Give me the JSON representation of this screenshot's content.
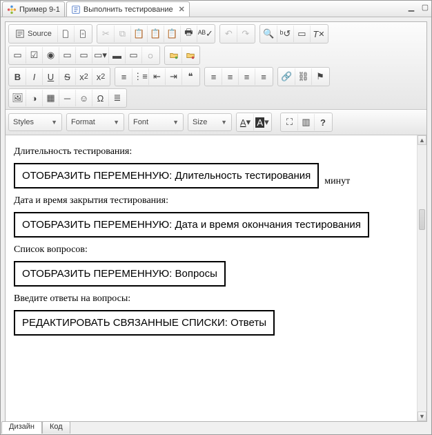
{
  "tabs": {
    "left": "Пример 9-1",
    "right": "Выполнить тестирование"
  },
  "toolbar": {
    "source_label": "Source"
  },
  "dropdowns": {
    "styles": "Styles",
    "format": "Format",
    "font": "Font",
    "size": "Size"
  },
  "content": {
    "p1": "Длительность тестирования:",
    "box1": "ОТОБРАЗИТЬ ПЕРЕМЕННУЮ: Длительность тестирования",
    "suffix1": "минут",
    "p2": "Дата и время закрытия тестирования:",
    "box2": "ОТОБРАЗИТЬ ПЕРЕМЕННУЮ: Дата и время окончания тестирования",
    "p3": "Список вопросов:",
    "box3": "ОТОБРАЗИТЬ ПЕРЕМЕННУЮ: Вопросы",
    "p4": "Введите ответы на вопросы:",
    "box4": "РЕДАКТИРОВАТЬ СВЯЗАННЫЕ СПИСКИ: Ответы"
  },
  "bottom_tabs": {
    "design": "Дизайн",
    "code": "Код"
  }
}
